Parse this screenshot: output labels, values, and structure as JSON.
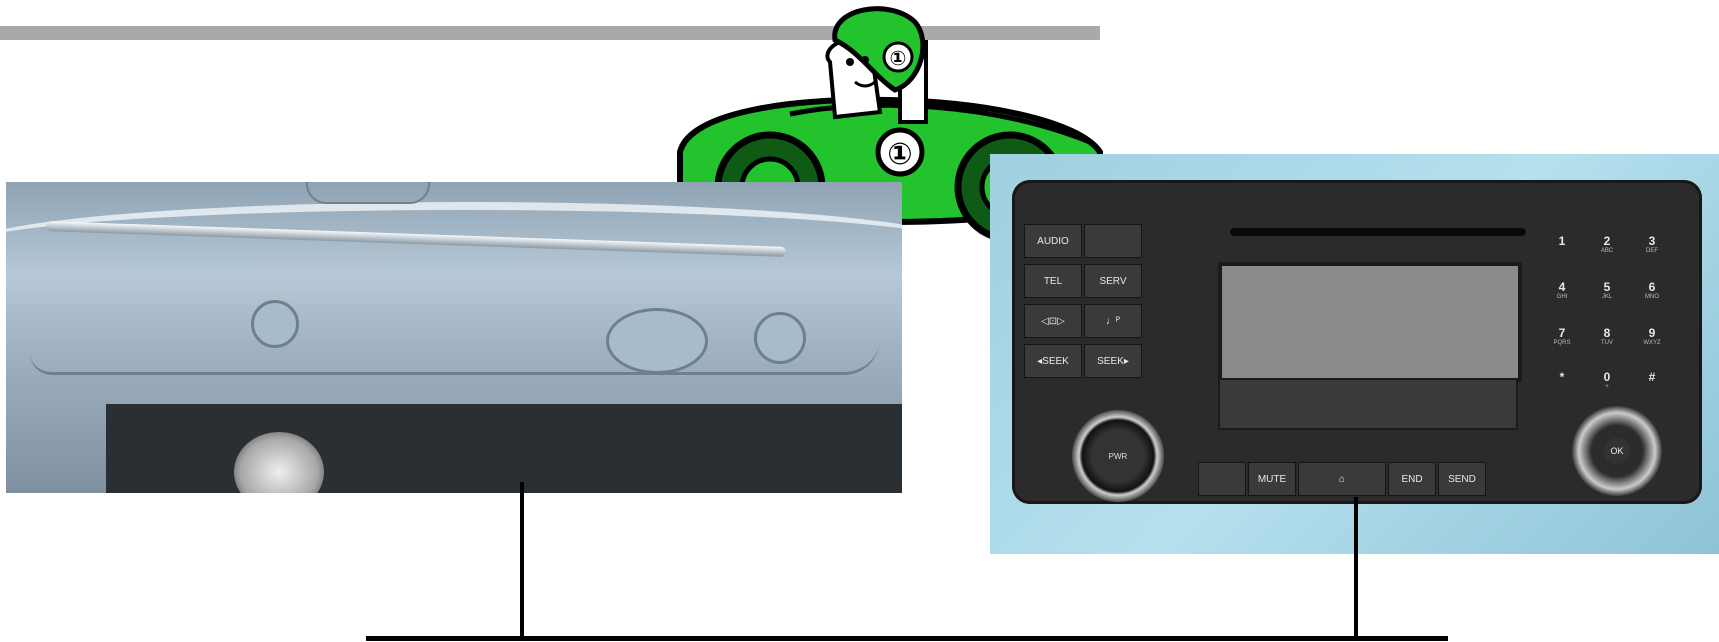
{
  "mascot": {
    "badge_helmet": "①",
    "badge_car": "①",
    "body_color": "#22c32c"
  },
  "radio": {
    "left_buttons": [
      "AUDIO",
      "",
      "TEL",
      "SERV",
      "◁⊡▷",
      "♩ᴾ",
      "◂SEEK",
      "SEEK▸"
    ],
    "keypad": [
      {
        "num": "1",
        "sub": ""
      },
      {
        "num": "2",
        "sub": "ABC"
      },
      {
        "num": "3",
        "sub": "DEF"
      },
      {
        "num": "4",
        "sub": "GHI"
      },
      {
        "num": "5",
        "sub": "JKL"
      },
      {
        "num": "6",
        "sub": "MNO"
      },
      {
        "num": "7",
        "sub": "PQRS"
      },
      {
        "num": "8",
        "sub": "TUV"
      },
      {
        "num": "9",
        "sub": "WXYZ"
      },
      {
        "num": "*",
        "sub": ""
      },
      {
        "num": "0",
        "sub": "+"
      },
      {
        "num": "#",
        "sub": ""
      }
    ],
    "bottom_buttons": [
      "",
      "MUTE",
      "⌂",
      "END",
      "SEND"
    ],
    "knob_label": "PWR",
    "ok_label": "OK"
  }
}
